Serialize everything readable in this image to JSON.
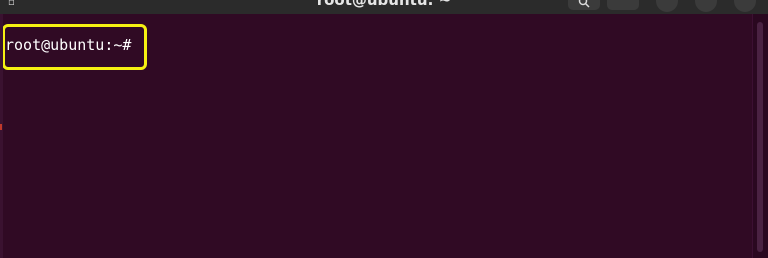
{
  "window": {
    "title": "root@ubuntu: ~"
  },
  "terminal": {
    "prompt": "root@ubuntu:~#",
    "input": ""
  },
  "colors": {
    "terminal_background": "#300a24",
    "highlight_border": "#f5f112",
    "text": "#ffffff"
  },
  "icons": {
    "tab_icon": "terminal-tab-icon",
    "search": "search-icon",
    "menu": "hamburger-menu-icon",
    "minimize": "minimize-icon",
    "maximize": "maximize-icon",
    "close": "close-icon"
  }
}
